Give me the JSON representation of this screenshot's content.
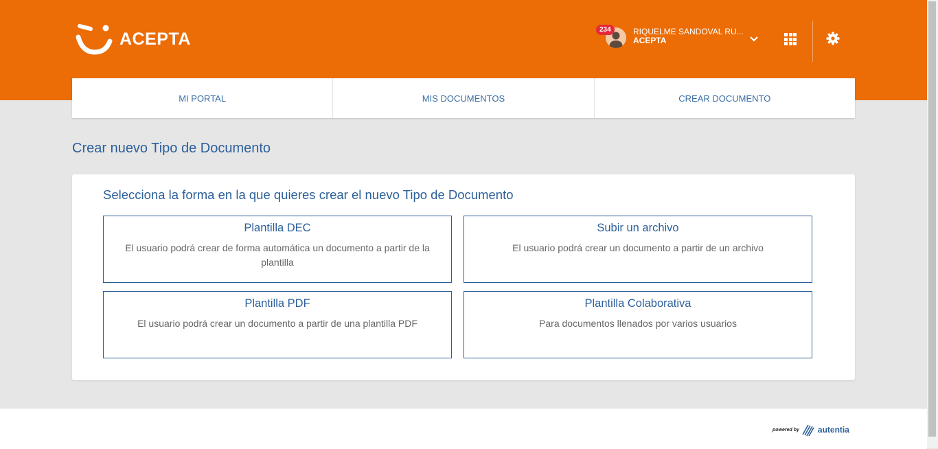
{
  "header": {
    "logo_text": "ACEPTA",
    "brand_color": "#ec6c06",
    "user": {
      "badge": "234",
      "name": "RIQUELME SANDOVAL RU...",
      "org": "ACEPTA"
    },
    "icons": [
      "chevron-down-icon",
      "apps-grid-icon",
      "gear-icon"
    ]
  },
  "nav": {
    "items": [
      {
        "label": "MI PORTAL"
      },
      {
        "label": "MIS DOCUMENTOS"
      },
      {
        "label": "CREAR DOCUMENTO"
      }
    ]
  },
  "main": {
    "page_title": "Crear nuevo Tipo de Documento",
    "card_title": "Selecciona la forma en la que quieres crear el nuevo Tipo de Documento",
    "options": [
      {
        "title": "Plantilla DEC",
        "desc": "El usuario podrá crear de forma automática un documento a partir de la plantilla"
      },
      {
        "title": "Subir un archivo",
        "desc": "El usuario podrá crear un documento a partir de un archivo"
      },
      {
        "title": "Plantilla PDF",
        "desc": "El usuario podrá crear un documento a partir de una plantilla PDF"
      },
      {
        "title": "Plantilla Colaborativa",
        "desc": "Para documentos llenados por varios usuarios"
      }
    ]
  },
  "footer": {
    "powered_by": "powered by",
    "brand": "autentia"
  }
}
